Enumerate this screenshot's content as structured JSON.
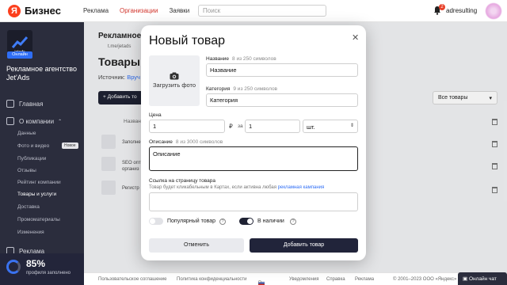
{
  "topbar": {
    "logo_letter": "Я",
    "logo_text": "Бизнес",
    "nav": [
      "Реклама",
      "Организации",
      "Заявки"
    ],
    "search_placeholder": "Поиск",
    "notification_count": "2",
    "user_name": "adresulting",
    "accent_color": "#d1342b"
  },
  "sidebar": {
    "company_logo_text": "jetads",
    "online_badge": "Онлайн",
    "company_name": "Рекламное агентство Jet'Ads",
    "items": [
      {
        "label": "Главная",
        "icon": "home-icon"
      },
      {
        "label": "О компании",
        "icon": "info-icon"
      },
      {
        "label": "Реклама",
        "icon": "ads-icon"
      }
    ],
    "sub_items": [
      "Данные",
      "Фото и видео",
      "Публикации",
      "Отзывы",
      "Рейтинг компании",
      "Товары и услуги",
      "Доставка",
      "Промоматериалы",
      "Изменения"
    ],
    "new_tag": "Новое",
    "progress_value": "85%",
    "progress_label": "профиля заполнено"
  },
  "background": {
    "title": "Рекламное а",
    "link": "t.me/jetads",
    "section_title": "Товары",
    "source_label": "Источник:",
    "source_value": "Вруч",
    "add_button": "+ Добавить то",
    "filter_select": "Все товары",
    "column_name": "Назван",
    "rows": [
      {
        "text_1": "Заполне",
        "text_2": ""
      },
      {
        "text_1": "SEO опти",
        "text_2": "организ"
      },
      {
        "text_1": "Регистр",
        "text_2": ""
      }
    ]
  },
  "footer": {
    "links": [
      "Пользовательское соглашение",
      "Политика конфиденциальности",
      "Ru",
      "Уведомления",
      "Справка",
      "Реклама",
      "© 2001–2023 ООО «Яндекс»"
    ],
    "chat_button": "Онлайн чат"
  },
  "modal": {
    "title": "Новый товар",
    "upload_label": "Загрузить фото",
    "name_label": "Название",
    "name_counter": "8 из 250 символов",
    "name_value": "Название",
    "category_label": "Категория",
    "category_counter": "9 из 250 символов",
    "category_value": "Категория",
    "price_label": "Цена",
    "price_value": "1",
    "currency": "₽",
    "per_label": "за",
    "quantity_value": "1",
    "unit_value": "шт.",
    "description_label": "Описание",
    "description_counter": "8 из 3000 символов",
    "description_value": "Описание",
    "link_label": "Ссылка на страницу товара",
    "link_hint": "Товар будет кликабельным в Картах, если активна любая",
    "link_hint_link": "рекламная кампания",
    "link_value": "",
    "popular_label": "Популярный товар",
    "popular_on": false,
    "in_stock_label": "В наличии",
    "in_stock_on": true,
    "cancel_button": "Отменить",
    "submit_button": "Добавить товар"
  }
}
